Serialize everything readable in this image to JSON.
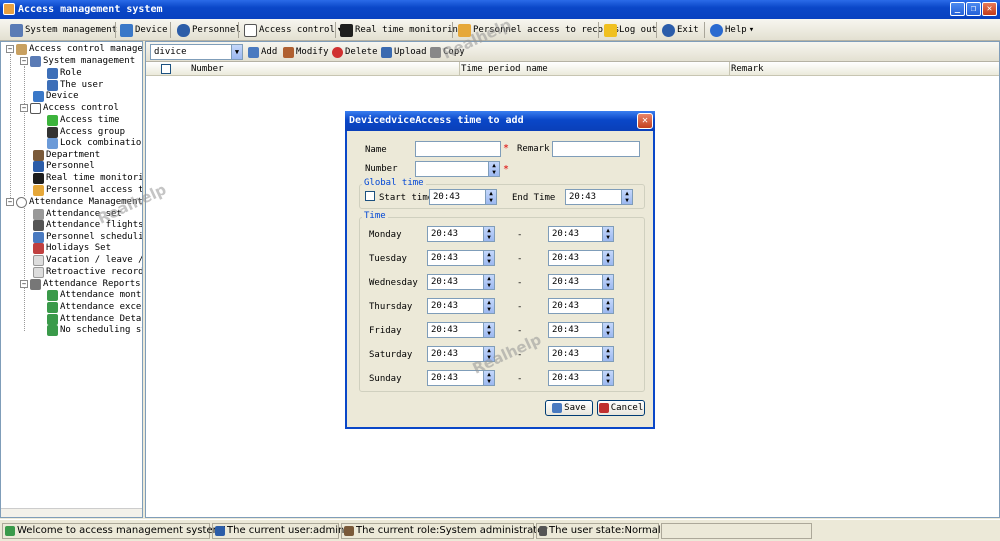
{
  "window": {
    "title": "Access management system"
  },
  "toolbar": {
    "system_management": "System management",
    "device": "Device",
    "personnel": "Personnel",
    "access_control": "Access control",
    "real_time_monitoring": "Real time monitoring",
    "personnel_access_records": "Personnel access to records",
    "log_out": "Log out",
    "exit": "Exit",
    "help": "Help"
  },
  "tree": {
    "items": [
      "Access control management",
      "System management",
      "Role",
      "The user",
      "Device",
      "Access control",
      "Access time",
      "Access group",
      "Lock combination",
      "Department",
      "Personnel",
      "Real time monitoring",
      "Personnel access to re",
      "Attendance Management",
      "Attendance set",
      "Attendance flights",
      "Personnel scheduling",
      "Holidays Set",
      "Vacation / leave / ove",
      "Retroactive record",
      "Attendance Reports",
      "Attendance monthly",
      "Attendance exceptio",
      "Attendance Detail R",
      "No scheduling stati"
    ]
  },
  "subbar": {
    "combo_value": "divice",
    "add": "Add",
    "modify": "Modify",
    "delete": "Delete",
    "upload": "Upload",
    "copy": "Copy"
  },
  "grid": {
    "columns": [
      "Number",
      "Time period name",
      "Remark"
    ]
  },
  "dialog": {
    "title": "DevicedviceAccess time to add",
    "name_label": "Name",
    "remark_label": "Remark",
    "number_label": "Number",
    "required_mark": "*",
    "global_time_label": "Global time",
    "start_time_label": "Start time",
    "start_time_value": "20:43",
    "end_time_label": "End Time",
    "end_time_value": "20:43",
    "time_group_label": "Time",
    "dash": "-",
    "days": [
      {
        "day": "Monday",
        "start": "20:43",
        "end": "20:43"
      },
      {
        "day": "Tuesday",
        "start": "20:43",
        "end": "20:43"
      },
      {
        "day": "Wednesday",
        "start": "20:43",
        "end": "20:43"
      },
      {
        "day": "Thursday",
        "start": "20:43",
        "end": "20:43"
      },
      {
        "day": "Friday",
        "start": "20:43",
        "end": "20:43"
      },
      {
        "day": "Saturday",
        "start": "20:43",
        "end": "20:43"
      },
      {
        "day": "Sunday",
        "start": "20:43",
        "end": "20:43"
      }
    ],
    "save": "Save",
    "cancel": "Cancel"
  },
  "status": {
    "welcome": "Welcome to access management system!",
    "current_user": "The current user:admin",
    "current_role": "The current role:System administrator",
    "user_state": "The user state:Normal"
  },
  "watermark": {
    "text": "Realhelp"
  }
}
